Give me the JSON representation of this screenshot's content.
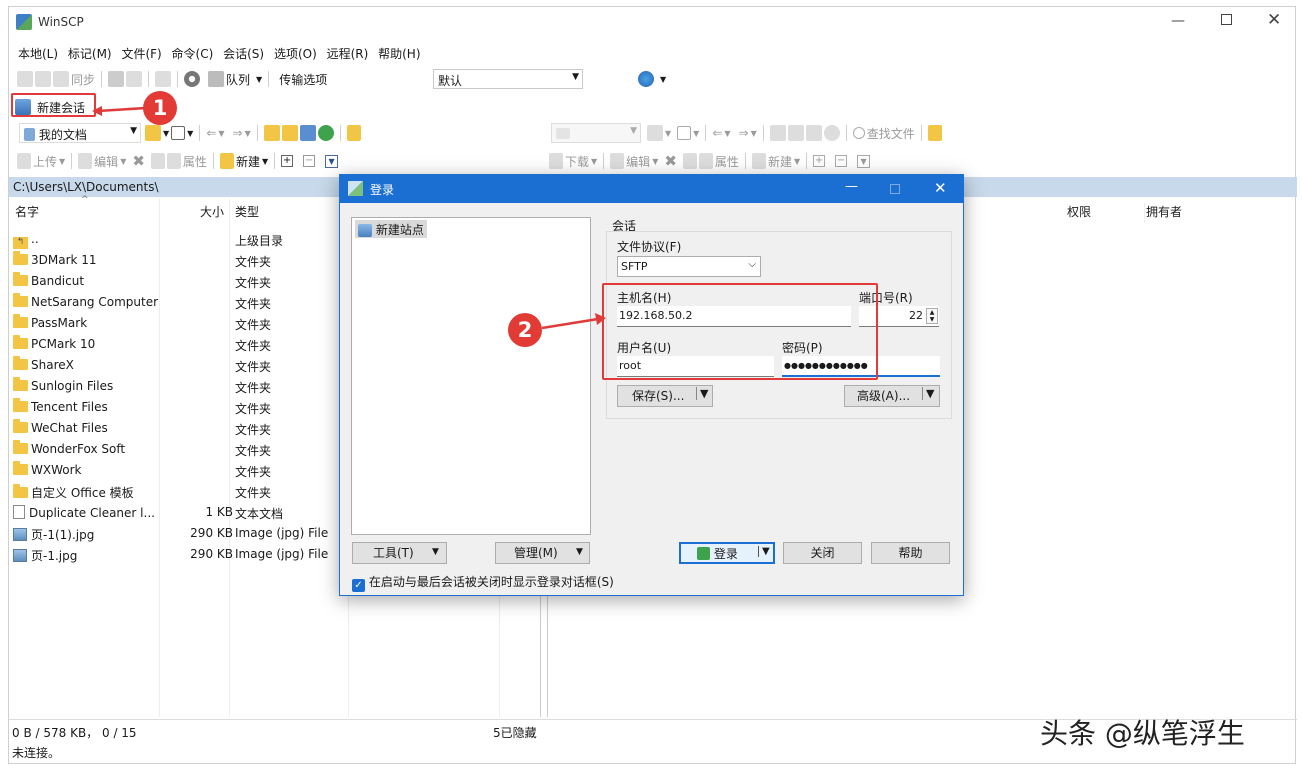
{
  "window": {
    "title": "WinSCP"
  },
  "menu": [
    "本地(L)",
    "标记(M)",
    "文件(F)",
    "命令(C)",
    "会话(S)",
    "选项(O)",
    "远程(R)",
    "帮助(H)"
  ],
  "toolbar": {
    "sync": "同步",
    "queue": "队列",
    "transfer_options_label": "传输选项",
    "transfer_options_value": "默认",
    "new_session": "新建会话"
  },
  "local": {
    "location": "我的文档",
    "upload": "上传",
    "edit": "编辑",
    "properties": "属性",
    "new": "新建",
    "path": "C:\\Users\\LX\\Documents\\",
    "columns": {
      "name": "名字",
      "size": "大小",
      "type": "类型"
    },
    "files": [
      {
        "name": "..",
        "size": "",
        "type": "上级目录",
        "kind": "up"
      },
      {
        "name": "3DMark 11",
        "size": "",
        "type": "文件夹",
        "kind": "folder"
      },
      {
        "name": "Bandicut",
        "size": "",
        "type": "文件夹",
        "kind": "folder"
      },
      {
        "name": "NetSarang Computer",
        "size": "",
        "type": "文件夹",
        "kind": "folder"
      },
      {
        "name": "PassMark",
        "size": "",
        "type": "文件夹",
        "kind": "folder"
      },
      {
        "name": "PCMark 10",
        "size": "",
        "type": "文件夹",
        "kind": "folder"
      },
      {
        "name": "ShareX",
        "size": "",
        "type": "文件夹",
        "kind": "folder"
      },
      {
        "name": "Sunlogin Files",
        "size": "",
        "type": "文件夹",
        "kind": "folder"
      },
      {
        "name": "Tencent Files",
        "size": "",
        "type": "文件夹",
        "kind": "folder"
      },
      {
        "name": "WeChat Files",
        "size": "",
        "type": "文件夹",
        "kind": "folder"
      },
      {
        "name": "WonderFox Soft",
        "size": "",
        "type": "文件夹",
        "kind": "folder"
      },
      {
        "name": "WXWork",
        "size": "",
        "type": "文件夹",
        "kind": "folder"
      },
      {
        "name": "自定义 Office 模板",
        "size": "",
        "type": "文件夹",
        "kind": "folder"
      },
      {
        "name": "Duplicate Cleaner l...",
        "size": "1 KB",
        "type": "文本文档",
        "kind": "file"
      },
      {
        "name": "页-1(1).jpg",
        "size": "290 KB",
        "type": "Image (jpg) File",
        "kind": "image"
      },
      {
        "name": "页-1.jpg",
        "size": "290 KB",
        "type": "Image (jpg) File",
        "kind": "image"
      }
    ],
    "status": "0 B / 578 KB， 0 / 15",
    "hidden": "5已隐藏"
  },
  "remote": {
    "download": "下载",
    "edit": "编辑",
    "properties": "属性",
    "new": "新建",
    "find_files": "查找文件",
    "columns": {
      "rights": "权限",
      "owner": "拥有者"
    }
  },
  "statusbar": {
    "connection": "未连接。"
  },
  "dialog": {
    "title": "登录",
    "site_item": "新建站点",
    "session_group": "会话",
    "protocol_label": "文件协议(F)",
    "protocol_value": "SFTP",
    "host_label": "主机名(H)",
    "host_value": "192.168.50.2",
    "port_label": "端口号(R)",
    "port_value": "22",
    "user_label": "用户名(U)",
    "user_value": "root",
    "password_label": "密码(P)",
    "password_value": "●●●●●●●●●●●●",
    "save_button": "保存(S)...",
    "advanced_button": "高级(A)...",
    "tools_button": "工具(T)",
    "manage_button": "管理(M)",
    "login_button": "登录",
    "close_button": "关闭",
    "help_button": "帮助",
    "show_checkbox": "在启动与最后会话被关闭时显示登录对话框(S)"
  },
  "annotations": {
    "step1": "1",
    "step2": "2"
  },
  "watermark": "头条 @纵笔浮生",
  "colors": {
    "accent": "#1c6fd2",
    "highlight": "#e03a3a",
    "path_bar": "#c7d9ea"
  }
}
